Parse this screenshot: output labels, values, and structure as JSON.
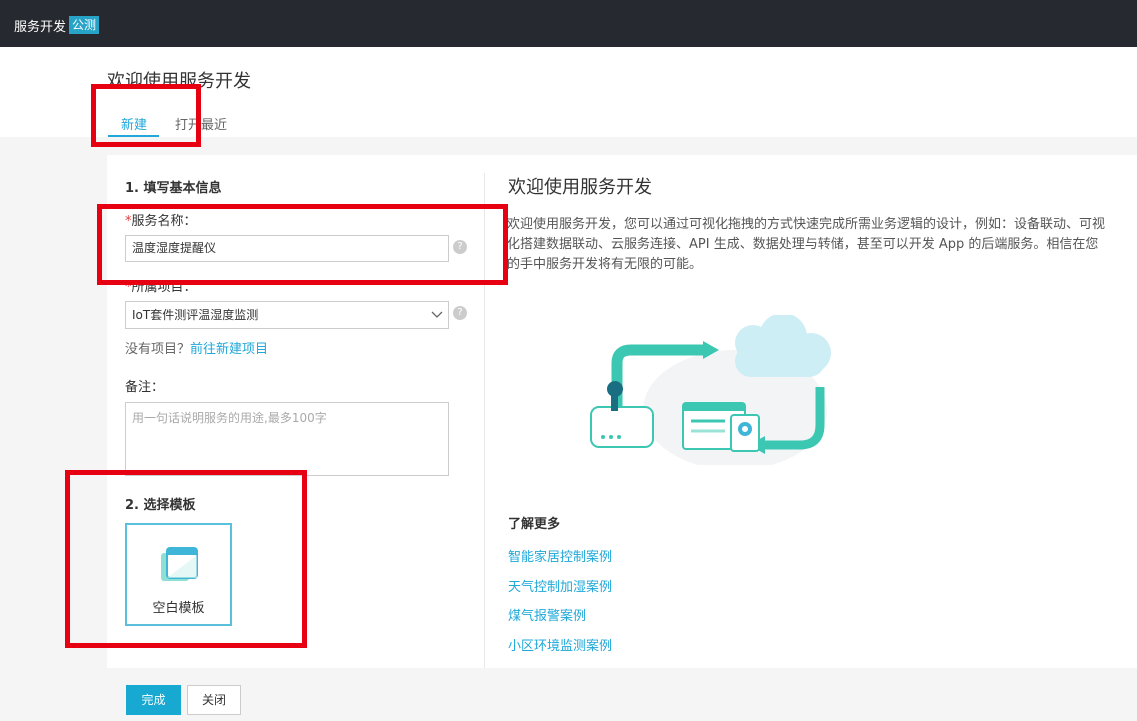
{
  "topbar": {
    "brand": "服务开发",
    "badge": "公测"
  },
  "header": {
    "title": "欢迎使用服务开发",
    "tabs": [
      {
        "label": "新建",
        "active": true
      },
      {
        "label": "打开最近",
        "active": false
      }
    ]
  },
  "form": {
    "step1_title": "1. 填写基本信息",
    "service_name_label": "服务名称：",
    "required_mark": "*",
    "service_name_value": "温度湿度提醒仪",
    "project_label": "所属项目：",
    "project_value": "IoT套件测评温湿度监测",
    "no_project_text": "没有项目？",
    "new_project_link": "前往新建项目",
    "note_label": "备注：",
    "note_placeholder": "用一句话说明服务的用途,最多100字",
    "help_icon": "?",
    "step2_title": "2. 选择模板",
    "template_label": "空白模板"
  },
  "intro": {
    "title": "欢迎使用服务开发",
    "description": "欢迎使用服务开发，您可以通过可视化拖拽的方式快速完成所需业务逻辑的设计，例如：设备联动、可视化搭建数据联动、云服务连接、API 生成、数据处理与转储，甚至可以开发 App 的后端服务。相信在您的手中服务开发将有无限的可能。",
    "learn_more": "了解更多",
    "cases": [
      "智能家居控制案例",
      "天气控制加湿案例",
      "煤气报警案例",
      "小区环境监测案例"
    ]
  },
  "footer": {
    "done": "完成",
    "close": "关闭"
  },
  "colors": {
    "accent": "#1fa8d9",
    "topbar": "#262a30",
    "annotation": "#e60012"
  }
}
